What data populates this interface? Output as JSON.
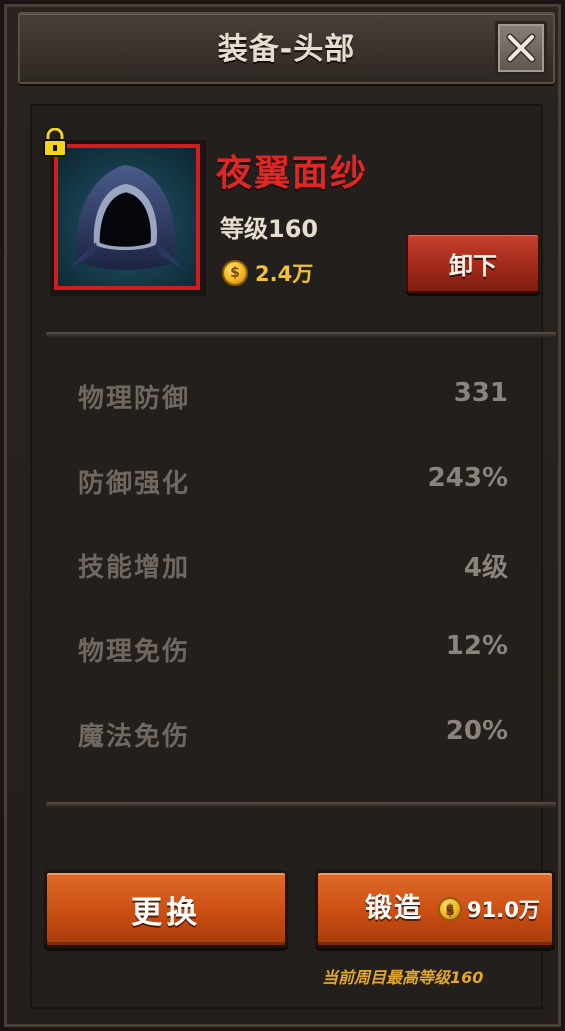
{
  "header": {
    "title": "装备-头部",
    "close_icon": "close-icon"
  },
  "item": {
    "name": "夜翼面纱",
    "level": "等级160",
    "price": "2.4万",
    "icon": "hooded-veil-icon",
    "locked": true,
    "rarity_color": "#d01e1e",
    "unequip_label": "卸下"
  },
  "stats": [
    {
      "label": "物理防御",
      "value": "331"
    },
    {
      "label": "防御强化",
      "value": "243%"
    },
    {
      "label": "技能增加",
      "value": "4级"
    },
    {
      "label": "物理免伤",
      "value": "12%"
    },
    {
      "label": "魔法免伤",
      "value": "20%"
    }
  ],
  "actions": {
    "replace_label": "更换",
    "forge_label": "锻造",
    "forge_cost": "91.0万",
    "note": "当前周目最高等级160"
  },
  "colors": {
    "item_name": "#e12626",
    "gold": "#f1c232",
    "button_orange": "#c94e12",
    "button_red": "#9e2818"
  }
}
